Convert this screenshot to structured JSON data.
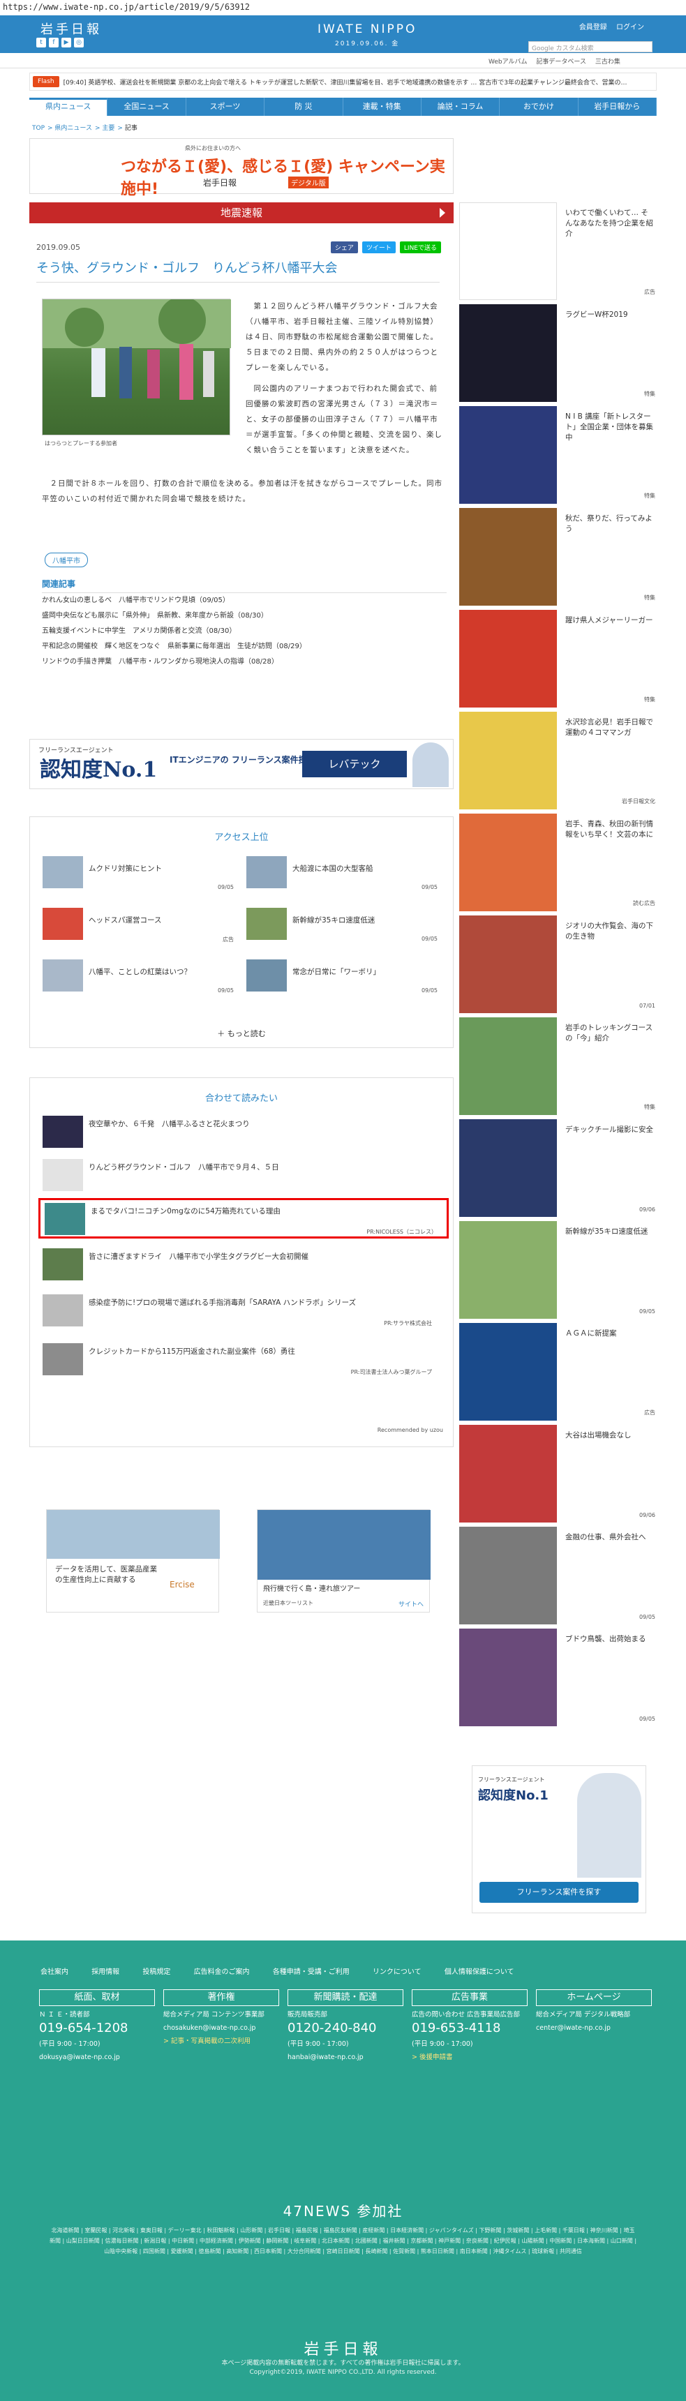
{
  "url": "https://www.iwate-np.co.jp/article/2019/9/5/63912",
  "header": {
    "logo": "岩手日報",
    "brand": "IWATE NIPPO",
    "date": "2019.09.06. 金",
    "account": [
      "会員登録",
      "ログイン"
    ],
    "search_placeholder": "Google カスタム検索",
    "sublinks": [
      "Webアルバム",
      "記事データベース",
      "三古わ集"
    ]
  },
  "flash": {
    "tag": "Flash",
    "text": "[09:40] 英語学校、運送会社を新規開業  京都の北上向会で増える トキッテが運営した新駅で、津田川集留場を目、岩手で地域連携の数値を示す … 宮古市で3年の起業チャレンジ最終会合で、営業の…"
  },
  "nav": [
    "県内ニュース",
    "全国ニュース",
    "スポーツ",
    "防 災",
    "連載・特集",
    "論説・コラム",
    "おでかけ",
    "岩手日報から"
  ],
  "breadcrumb": [
    "TOP",
    "県内ニュース",
    "主要",
    "記事"
  ],
  "banner_top": {
    "small": "県外にお住まいの方へ",
    "main": "つながるＩ(愛)、感じるＩ(愛) キャンペーン実施中!",
    "sub": "岩手日報",
    "sub2": "デジタル版"
  },
  "jishin": "地震速報",
  "article": {
    "date": "2019.09.05",
    "share": [
      "シェア",
      "ツイート",
      "LINEで送る"
    ],
    "title": "そう快、グラウンド・ゴルフ　りんどう杯八幡平大会",
    "caption": "はつらつとプレーする参加者",
    "p1": "　第１２回りんどう杯八幡平グラウンド・ゴルフ大会（八幡平市、岩手日報社主催、三陸ソイル特別協賛）は４日、同市野駄の市松尾総合運動公園で開催した。５日までの２日間、県内外の約２５０人がはつらつとプレーを楽しんでいる。",
    "p2": "　同公園内のアリーナまつおで行われた開会式で、前回優勝の紫波町西の宮澤光男さん（７３）＝滝沢市＝と、女子の部優勝の山田淳子さん（７７）＝八幡平市＝が選手宣誓。「多くの仲間と親睦、交流を図り、楽しく競い合うことを誓います」と決意を述べた。",
    "p3": "　２日間で計８ホールを回り、打数の合計で順位を決める。参加者は汗を拭きながらコースでプレーした。同市平笠のいこいの村付近で開かれた同会場で競技を続けた。",
    "tag": "八幡平市"
  },
  "related": {
    "title": "関連記事",
    "items": [
      "かれん女山の恵しるべ　八幡平市でリンドウ見頃（09/05）",
      "盛岡中央伝なども展示に「県外伸」　県新教、来年度から新設（08/30）",
      "五輪支援イベントに中学生　アメリカ関係者と交流（08/30）",
      "平和記念の開催校　輝く地区をつなぐ　県新事業に毎年選出　生徒が訪問（08/29）",
      "リンドウの手描き押葉　八幡平市・ルワンダから現地決人の指導（08/28）"
    ]
  },
  "ad_wide": {
    "l1": "フリーランスエージェント",
    "no1": "認知度No.1",
    "mid": "ITエンジニアの\nフリーランス案件探しは",
    "btn": "レバテック"
  },
  "access": {
    "title": "アクセス上位",
    "items": [
      {
        "t": "ムクドリ対策にヒント",
        "n": "09/05"
      },
      {
        "t": "大船渡に本国の大型客船",
        "n": "09/05"
      },
      {
        "t": "ヘッドスパ運営コース",
        "n": "広告"
      },
      {
        "t": "新幹線が35キロ速度低迷",
        "n": "09/05"
      },
      {
        "t": "八幡平、ことしの紅葉はいつ？",
        "n": "09/05"
      },
      {
        "t": "常念が日常に「ワーボリ」",
        "n": "09/05"
      }
    ],
    "more": "もっと読む"
  },
  "recommend": {
    "title": "合わせて読みたい",
    "items": [
      {
        "t": "夜空華やか、６千発　八幡平ふるさと花火まつり",
        "pr": ""
      },
      {
        "t": "りんどう杯グラウンド・ゴルフ　八幡平市で９月４、５日",
        "pr": ""
      },
      {
        "t": "まるでタバコ!ニコチン0mgなのに54万箱売れている理由",
        "pr": "PR:NICOLESS（ニコレス）"
      },
      {
        "t": "皆さに漕ぎますドライ　八幡平市で小学生タグラグビー大会初開催",
        "pr": ""
      },
      {
        "t": "感染症予防に!プロの現場で選ばれる手指消毒剤「SARAYA ハンドラボ」シリーズ",
        "pr": "PR:サラヤ株式会社"
      },
      {
        "t": "クレジットカードから115万円返金された副业案件（68）勇往",
        "pr": "PR:司法書士法人みつ葉グループ"
      }
    ],
    "footer": "Recommended by uzou"
  },
  "ad_pair": {
    "a": "データを活用して、医薬品産業の生産性向上に貢献する",
    "a_brand": "Ercise",
    "b": "飛行機で行く島・連れ旅ツアー",
    "b_brand": "近畿日本ツーリスト",
    "b_link": "サイトへ"
  },
  "sidebar": [
    {
      "t": "いわてで働くいわて… そんなあなたを持つ企業を紹介",
      "c": "広告"
    },
    {
      "t": "ラグビーW杯2019",
      "c": "特集"
    },
    {
      "t": "N I B 講座「新トレスタート」全国企業・団体を募集中",
      "c": "特集"
    },
    {
      "t": "秋だ、祭りだ、行ってみよう",
      "c": "特集"
    },
    {
      "t": "躍け県人メジャーリーガー",
      "c": "特集"
    },
    {
      "t": "水沢珍言必見！岩手日報で運動の４コママンガ",
      "c": "岩手日報文化"
    },
    {
      "t": "岩手、青森、秋田の新刊情報をいち早く！文芸の本に",
      "c": "読む広告"
    },
    {
      "t": "ジオリの大作覧会、海の下の生き物",
      "c": "07/01"
    },
    {
      "t": "岩手のトレッキングコースの「今」紹介",
      "c": "特集"
    },
    {
      "t": "デキックチール撮影に安全",
      "c": "09/06"
    },
    {
      "t": "新幹線が35キロ速度低迷",
      "c": "09/05"
    },
    {
      "t": "ＡＧＡに新提案",
      "c": "広告"
    },
    {
      "t": "大谷は出場機会なし",
      "c": "09/06"
    },
    {
      "t": "金融の仕事、県外会社へ",
      "c": "09/05"
    },
    {
      "t": "ブドウ鳥襲、出荷始まる",
      "c": "09/05"
    }
  ],
  "side_ad": {
    "l1": "フリーランスエージェント",
    "no1": "認知度No.1",
    "btn": "フリーランス案件を探す"
  },
  "footer": {
    "links": [
      "会社案内",
      "採用情報",
      "投稿規定",
      "広告料金のご案内",
      "各種申請・受講・ご利用",
      "リンクについて",
      "個人情報保護について"
    ],
    "cols": [
      {
        "h": "紙面、取材",
        "l": "Ｎ Ｉ Ｅ・読者部",
        "tel": "019-654-1208",
        "l2": "(平日 9:00 - 17:00)",
        "l3": "dokusya@iwate-np.co.jp"
      },
      {
        "h": "著作権",
        "l": "総合メディア局 コンテンツ事業部",
        "tel": "",
        "l2": "chosakuken@iwate-np.co.jp",
        "l3": "> 記事・写真掲載の二次利用"
      },
      {
        "h": "新聞購読・配達",
        "l": "販売局販売部",
        "tel": "0120-240-840",
        "l2": "(平日 9:00 - 17:00)",
        "l3": "hanbai@iwate-np.co.jp"
      },
      {
        "h": "広告事業",
        "l": "広告の問い合わせ 広告事業局広告部",
        "tel": "019-653-4118",
        "l2": "(平日 9:00 - 17:00)",
        "l3": "> 後援申請書"
      },
      {
        "h": "ホームページ",
        "l": "総合メディア局 デジタル戦略部",
        "tel": "",
        "l2": "center@iwate-np.co.jp",
        "l3": ""
      }
    ],
    "f47": "47NEWS 参加社",
    "f47_list": "北海道新聞 | 室蘭民報 | 河北新報 | 東奥日報 | デーリー東北 | 秋田魁新報 | 山形新聞 | 岩手日報 | 福島民報 | 福島民友新聞 | 産経新聞 | 日本経済新聞 | ジャパンタイムズ | 下野新聞 | 茨城新聞 | 上毛新聞 | 千葉日報 | 神奈川新聞 | 埼玉新聞 | 山梨日日新聞 | 信濃毎日新聞 | 新潟日報 | 中日新聞 | 中部経済新聞 | 伊勢新聞 | 静岡新聞 | 岐阜新聞 | 北日本新聞 | 北國新聞 | 福井新聞 | 京都新聞 | 神戸新聞 | 奈良新聞 | 紀伊民報 | 山陽新聞 | 中国新聞 | 日本海新聞 | 山口新聞 | 山陰中央新報 | 四国新聞 | 愛媛新聞 | 徳島新聞 | 高知新聞 | 西日本新聞 | 大分合同新聞 | 宮崎日日新聞 | 長崎新聞 | 佐賀新聞 | 熊本日日新聞 | 南日本新聞 | 沖縄タイムス | 琉球新報 | 共同通信",
    "logo": "岩手日報",
    "copy1": "本ページ掲載内容の無断転載を禁じます。すべての著作権は岩手日報社に帰属します。",
    "copy2": "Copyright©2019, IWATE NIPPO CO.,LTD. All rights reserved."
  }
}
